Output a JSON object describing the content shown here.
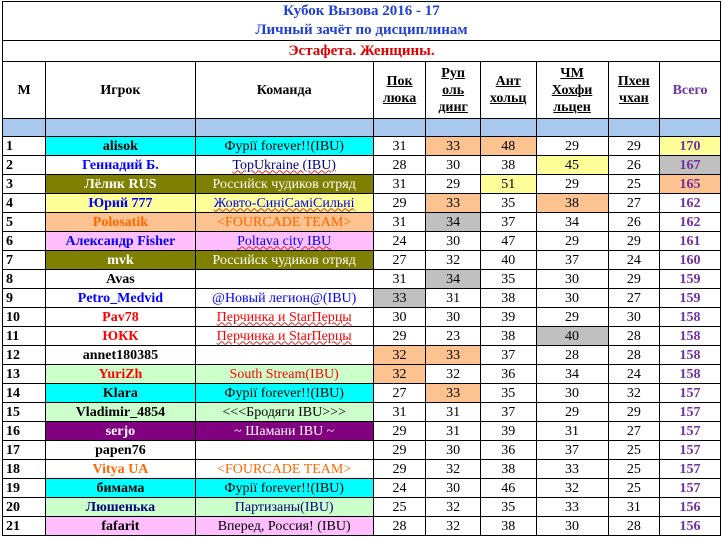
{
  "title_line1": "Кубок Вызова 2016 - 17",
  "title_line2": "Личный зачёт по дисциплинам",
  "title_line3": "Эстафета. Женщины.",
  "headers": {
    "rank": "М",
    "player": "Игрок",
    "team": "Команда",
    "d1": [
      "Пок",
      "люка"
    ],
    "d2": [
      "Руп",
      "оль",
      "динг"
    ],
    "d3": [
      "Ант",
      "хольц"
    ],
    "d4": [
      "ЧМ",
      "Хохфи",
      "льцен"
    ],
    "d5": [
      "Пхен",
      "чхан"
    ],
    "total": "Всего"
  },
  "colors": {
    "cyan": "#00ffff",
    "olive": "#7f7f00",
    "yellow": "#ffff99",
    "orange": "#fcc28f",
    "gray": "#c0c0c0",
    "pink": "#ffbfff",
    "green": "#ccffcc",
    "purple": "#800080",
    "white": "#ffffff",
    "blue_text": "#0000ff",
    "red_text": "#ff0000",
    "orange_text": "#ff6600",
    "navy_text": "#000080",
    "black_text": "#000000"
  },
  "rows": [
    {
      "rank": "1",
      "player": "alisok",
      "team": "Фурії forever!!(IBU)",
      "scores": [
        "31",
        "33",
        "48",
        "29",
        "29"
      ],
      "total": "170",
      "player_bg": "cyan",
      "player_color": "black_text",
      "team_bg": "cyan",
      "team_color": "black_text",
      "team_wavy": false,
      "score_bg": [
        "",
        "orange",
        "orange",
        "",
        ""
      ],
      "total_bg": "yellow"
    },
    {
      "rank": "2",
      "player": "Геннадий Б.",
      "team": "TopUkraine (IBU)",
      "scores": [
        "28",
        "30",
        "38",
        "45",
        "26"
      ],
      "total": "167",
      "player_bg": "white",
      "player_color": "blue_text",
      "team_bg": "white",
      "team_color": "navy_text",
      "team_wavy": true,
      "score_bg": [
        "",
        "",
        "",
        "yellow",
        ""
      ],
      "total_bg": "gray"
    },
    {
      "rank": "3",
      "player": "Лёлик RUS",
      "team": "Российск чудиков отряд",
      "scores": [
        "31",
        "29",
        "51",
        "29",
        "25"
      ],
      "total": "165",
      "player_bg": "olive",
      "player_color": "white",
      "team_bg": "olive",
      "team_color": "white",
      "team_wavy": false,
      "score_bg": [
        "",
        "",
        "yellow",
        "",
        ""
      ],
      "total_bg": "orange"
    },
    {
      "rank": "4",
      "player": "Юрий 777",
      "team": "Жовто-СиніСаміСильні",
      "scores": [
        "29",
        "33",
        "35",
        "38",
        "27"
      ],
      "total": "162",
      "player_bg": "yellow",
      "player_color": "blue_text",
      "team_bg": "yellow",
      "team_color": "blue_text",
      "team_wavy": true,
      "score_bg": [
        "",
        "orange",
        "",
        "orange",
        ""
      ],
      "total_bg": "white"
    },
    {
      "rank": "5",
      "player": "Polosatik",
      "team": "<FOURCADE TEAM>",
      "scores": [
        "31",
        "34",
        "37",
        "34",
        "26"
      ],
      "total": "162",
      "player_bg": "orange",
      "player_color": "orange_text",
      "team_bg": "orange",
      "team_color": "orange_text",
      "team_wavy": false,
      "score_bg": [
        "",
        "gray",
        "",
        "",
        ""
      ],
      "total_bg": "white"
    },
    {
      "rank": "6",
      "player": "Александр Fisher",
      "team": "Poltava city IBU",
      "scores": [
        "24",
        "30",
        "47",
        "29",
        "29"
      ],
      "total": "161",
      "player_bg": "pink",
      "player_color": "blue_text",
      "team_bg": "pink",
      "team_color": "blue_text",
      "team_wavy": true,
      "score_bg": [
        "",
        "",
        "",
        "",
        ""
      ],
      "total_bg": "white"
    },
    {
      "rank": "7",
      "player": "mvk",
      "team": "Российск чудиков отряд",
      "scores": [
        "27",
        "32",
        "40",
        "37",
        "24"
      ],
      "total": "160",
      "player_bg": "olive",
      "player_color": "white",
      "team_bg": "olive",
      "team_color": "white",
      "team_wavy": false,
      "score_bg": [
        "",
        "",
        "",
        "",
        ""
      ],
      "total_bg": "white"
    },
    {
      "rank": "8",
      "player": "Avas",
      "team": "",
      "scores": [
        "31",
        "34",
        "35",
        "30",
        "29"
      ],
      "total": "159",
      "player_bg": "white",
      "player_color": "black_text",
      "team_bg": "white",
      "team_color": "black_text",
      "team_wavy": false,
      "score_bg": [
        "",
        "gray",
        "",
        "",
        ""
      ],
      "total_bg": "white"
    },
    {
      "rank": "9",
      "player": "Petro_Medvid",
      "team": "@Новый легион@(IBU)",
      "scores": [
        "33",
        "31",
        "38",
        "30",
        "27"
      ],
      "total": "159",
      "player_bg": "white",
      "player_color": "blue_text",
      "team_bg": "white",
      "team_color": "blue_text",
      "team_wavy": false,
      "score_bg": [
        "gray",
        "",
        "",
        "",
        ""
      ],
      "total_bg": "white"
    },
    {
      "rank": "10",
      "player": "Pav78",
      "team": "Перчинка и StarПерцы",
      "scores": [
        "30",
        "30",
        "39",
        "29",
        "30"
      ],
      "total": "158",
      "player_bg": "white",
      "player_color": "red_text",
      "team_bg": "white",
      "team_color": "red_text",
      "team_wavy": true,
      "score_bg": [
        "",
        "",
        "",
        "",
        ""
      ],
      "total_bg": "white"
    },
    {
      "rank": "11",
      "player": "ЮКК",
      "team": "Перчинка и StarПерцы",
      "scores": [
        "29",
        "23",
        "38",
        "40",
        "28"
      ],
      "total": "158",
      "player_bg": "white",
      "player_color": "red_text",
      "team_bg": "white",
      "team_color": "red_text",
      "team_wavy": true,
      "score_bg": [
        "",
        "",
        "",
        "gray",
        ""
      ],
      "total_bg": "white"
    },
    {
      "rank": "12",
      "player": "annet180385",
      "team": "",
      "scores": [
        "32",
        "33",
        "37",
        "28",
        "28"
      ],
      "total": "158",
      "player_bg": "white",
      "player_color": "black_text",
      "team_bg": "white",
      "team_color": "black_text",
      "team_wavy": false,
      "score_bg": [
        "orange",
        "orange",
        "",
        "",
        ""
      ],
      "total_bg": "white"
    },
    {
      "rank": "13",
      "player": "YuriZh",
      "team": "South Stream(IBU)",
      "scores": [
        "32",
        "32",
        "36",
        "34",
        "24"
      ],
      "total": "158",
      "player_bg": "green",
      "player_color": "red_text",
      "team_bg": "green",
      "team_color": "red_text",
      "team_wavy": false,
      "score_bg": [
        "orange",
        "",
        "",
        "",
        ""
      ],
      "total_bg": "white"
    },
    {
      "rank": "14",
      "player": "Klara",
      "team": "Фурії forever!!(IBU)",
      "scores": [
        "27",
        "33",
        "35",
        "30",
        "32"
      ],
      "total": "157",
      "player_bg": "cyan",
      "player_color": "black_text",
      "team_bg": "cyan",
      "team_color": "black_text",
      "team_wavy": false,
      "score_bg": [
        "",
        "orange",
        "",
        "",
        ""
      ],
      "total_bg": "white"
    },
    {
      "rank": "15",
      "player": "Vladimir_4854",
      "team": "<<<Бродяги IBU>>>",
      "scores": [
        "31",
        "31",
        "37",
        "29",
        "29"
      ],
      "total": "157",
      "player_bg": "green",
      "player_color": "black_text",
      "team_bg": "green",
      "team_color": "black_text",
      "team_wavy": false,
      "score_bg": [
        "",
        "",
        "",
        "",
        ""
      ],
      "total_bg": "white"
    },
    {
      "rank": "16",
      "player": "serjo",
      "team": "~ Шамани IBU ~",
      "scores": [
        "29",
        "31",
        "39",
        "31",
        "27"
      ],
      "total": "157",
      "player_bg": "purple",
      "player_color": "white",
      "team_bg": "purple",
      "team_color": "white",
      "team_wavy": false,
      "score_bg": [
        "",
        "",
        "",
        "",
        ""
      ],
      "total_bg": "white"
    },
    {
      "rank": "17",
      "player": "papen76",
      "team": "",
      "scores": [
        "29",
        "30",
        "36",
        "37",
        "25"
      ],
      "total": "157",
      "player_bg": "white",
      "player_color": "black_text",
      "team_bg": "white",
      "team_color": "black_text",
      "team_wavy": false,
      "score_bg": [
        "",
        "",
        "",
        "",
        ""
      ],
      "total_bg": "white"
    },
    {
      "rank": "18",
      "player": "Vitya UA",
      "team": "<FOURCADE TEAM>",
      "scores": [
        "29",
        "32",
        "38",
        "33",
        "25"
      ],
      "total": "157",
      "player_bg": "white",
      "player_color": "orange_text",
      "team_bg": "white",
      "team_color": "orange_text",
      "team_wavy": false,
      "score_bg": [
        "",
        "",
        "",
        "",
        ""
      ],
      "total_bg": "white"
    },
    {
      "rank": "19",
      "player": "бимама",
      "team": "Фурії forever!!(IBU)",
      "scores": [
        "24",
        "30",
        "46",
        "32",
        "25"
      ],
      "total": "157",
      "player_bg": "cyan",
      "player_color": "black_text",
      "team_bg": "cyan",
      "team_color": "black_text",
      "team_wavy": false,
      "score_bg": [
        "",
        "",
        "",
        "",
        ""
      ],
      "total_bg": "white"
    },
    {
      "rank": "20",
      "player": "Люшенька",
      "team": "Партизаны(IBU)",
      "scores": [
        "25",
        "32",
        "35",
        "33",
        "31"
      ],
      "total": "156",
      "player_bg": "green",
      "player_color": "navy_text",
      "team_bg": "green",
      "team_color": "navy_text",
      "team_wavy": false,
      "score_bg": [
        "",
        "",
        "",
        "",
        ""
      ],
      "total_bg": "white"
    },
    {
      "rank": "21",
      "player": "fafarit",
      "team": "Вперед, Россия! (IBU)",
      "scores": [
        "28",
        "32",
        "38",
        "30",
        "28"
      ],
      "total": "156",
      "player_bg": "pink",
      "player_color": "black_text",
      "team_bg": "pink",
      "team_color": "black_text",
      "team_wavy": false,
      "score_bg": [
        "",
        "",
        "",
        "",
        ""
      ],
      "total_bg": "white"
    }
  ]
}
